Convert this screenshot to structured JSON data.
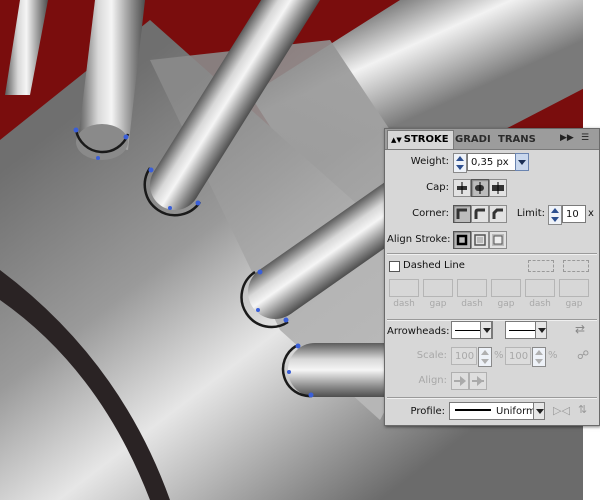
{
  "colors": {
    "background_red": "#7a0d0d",
    "selection_blue": "#3a5fd9",
    "panel_bg": "#d7d7d7",
    "tab_bar": "#9c9c9c"
  },
  "panel": {
    "tabs": [
      {
        "label": "STROKE",
        "active": true
      },
      {
        "label": "GRADI",
        "active": false
      },
      {
        "label": "TRANS",
        "active": false
      }
    ],
    "collapse_icon": "double-chevron-right-icon",
    "menu_icon": "panel-menu-icon",
    "weight": {
      "label": "Weight:",
      "value": "0,35 px"
    },
    "cap": {
      "label": "Cap:",
      "options": [
        "butt-cap-icon",
        "round-cap-icon",
        "projecting-cap-icon"
      ],
      "selected": 1
    },
    "corner": {
      "label": "Corner:",
      "options": [
        "miter-join-icon",
        "round-join-icon",
        "bevel-join-icon"
      ],
      "selected": 0
    },
    "limit": {
      "label": "Limit:",
      "value": "10",
      "unit": "x"
    },
    "align_stroke": {
      "label": "Align Stroke:",
      "options": [
        "align-center-icon",
        "align-inside-icon",
        "align-outside-icon"
      ],
      "selected": 0
    },
    "dashed_line": {
      "label": "Dashed Line",
      "checked": false
    },
    "dash_fields": [
      {
        "label": "dash",
        "value": ""
      },
      {
        "label": "gap",
        "value": ""
      },
      {
        "label": "dash",
        "value": ""
      },
      {
        "label": "gap",
        "value": ""
      },
      {
        "label": "dash",
        "value": ""
      },
      {
        "label": "gap",
        "value": ""
      }
    ],
    "arrowheads": {
      "label": "Arrowheads:",
      "start": "none",
      "end": "none"
    },
    "scale": {
      "label": "Scale:",
      "start": "100",
      "end": "100",
      "unit": "%"
    },
    "align": {
      "label": "Align:"
    },
    "profile": {
      "label": "Profile:",
      "value": "Uniform"
    }
  }
}
